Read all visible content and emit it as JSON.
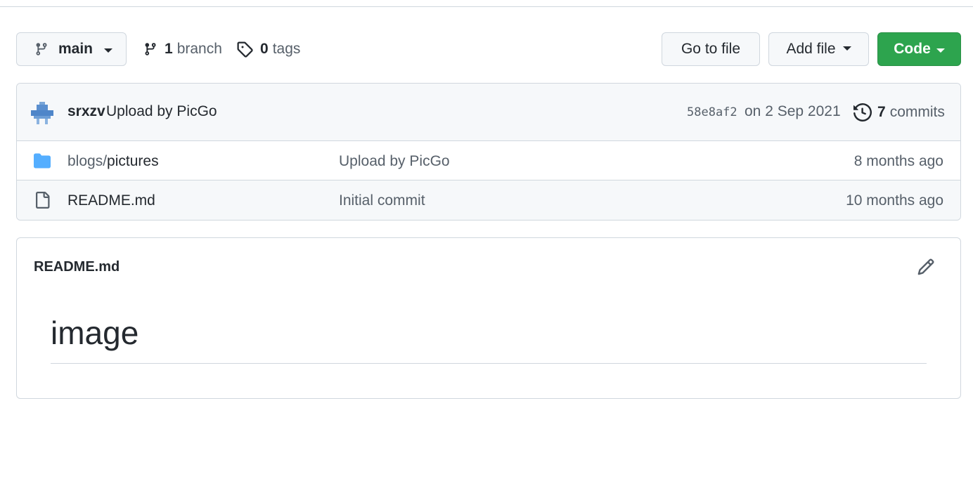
{
  "toolbar": {
    "branch_label": "main",
    "branch_count": "1",
    "branch_word": "branch",
    "tag_count": "0",
    "tag_word": "tags",
    "goto_file_label": "Go to file",
    "add_file_label": "Add file",
    "code_label": "Code",
    "code_color": "#2da44e"
  },
  "latest_commit": {
    "author": "srxzv",
    "message": "Upload by PicGo",
    "hash": "58e8af2",
    "date": "on 2 Sep 2021",
    "commit_count": "7",
    "commit_word": "commits"
  },
  "files": [
    {
      "type": "folder-icon",
      "dir": "blogs/",
      "name": "pictures",
      "message": "Upload by PicGo",
      "age": "8 months ago"
    },
    {
      "type": "file-icon",
      "dir": "",
      "name": "README.md",
      "message": "Initial commit",
      "age": "10 months ago"
    }
  ],
  "readme": {
    "title": "README.md",
    "heading": "image"
  }
}
